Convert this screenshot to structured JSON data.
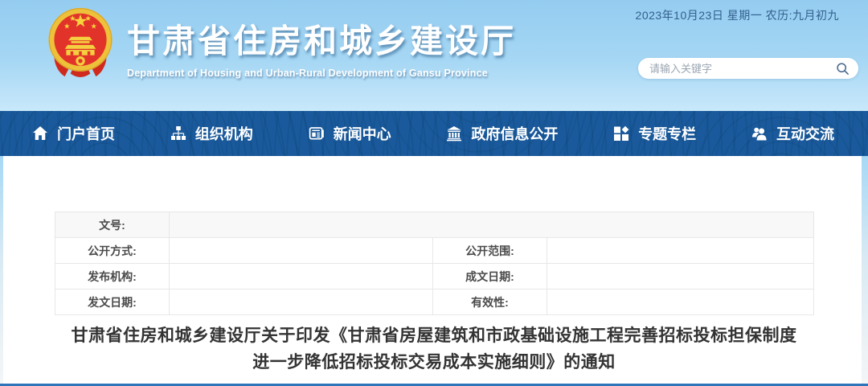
{
  "header": {
    "date_line": "2023年10月23日  星期一  农历:九月初九",
    "site_title_cn": "甘肃省住房和城乡建设厅",
    "site_title_en": "Department of Housing and Urban-Rural Development of Gansu Province",
    "search": {
      "placeholder": "请输入关键字",
      "value": ""
    }
  },
  "nav": {
    "items": [
      {
        "label": "门户首页",
        "icon": "home-icon"
      },
      {
        "label": "组织机构",
        "icon": "sitemap-icon"
      },
      {
        "label": "新闻中心",
        "icon": "newspaper-icon"
      },
      {
        "label": "政府信息公开",
        "icon": "gov-building-icon"
      },
      {
        "label": "专题专栏",
        "icon": "topics-grid-icon"
      },
      {
        "label": "互动交流",
        "icon": "people-icon"
      }
    ]
  },
  "doc_meta": {
    "row1": {
      "label": "文号:",
      "value": ""
    },
    "rows": [
      {
        "l1": "公开方式:",
        "v1": "",
        "l2": "公开范围:",
        "v2": ""
      },
      {
        "l1": "发布机构:",
        "v1": "",
        "l2": "成文日期:",
        "v2": ""
      },
      {
        "l1": "发文日期:",
        "v1": "",
        "l2": "有效性:",
        "v2": ""
      }
    ]
  },
  "article": {
    "title": "甘肃省住房和城乡建设厅关于印发《甘肃省房屋建筑和市政基础设施工程完善招标投标担保制度进一步降低招标投标交易成本实施细则》的通知"
  },
  "colors": {
    "nav_blue": "#1a5a9c",
    "sky_blue": "#a6d7f4",
    "emblem_red": "#e2332a",
    "emblem_gold": "#eec13a",
    "bottom_rule_blue": "#2e74b8",
    "date_text": "#33608d",
    "table_border": "#e7e7e7",
    "title_text": "#333333"
  }
}
